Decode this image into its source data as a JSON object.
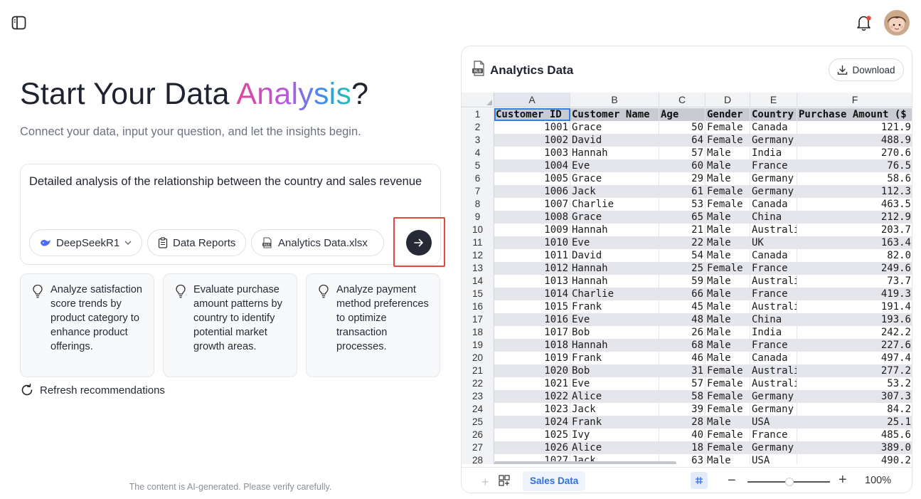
{
  "hero": {
    "title_prefix": "Start Your Data ",
    "title_highlight": "Analysis",
    "title_suffix": "?",
    "subtitle": "Connect your data, input your question, and let the insights begin."
  },
  "prompt": {
    "text": "Detailed analysis of the relationship between the country and sales revenue",
    "chips": [
      {
        "label": "DeepSeekR1",
        "icon": "deepseek-whale-icon"
      },
      {
        "label": "Data Reports",
        "icon": "clipboard-icon"
      },
      {
        "label": "Analytics Data.xlsx",
        "icon": "xls-file-icon"
      }
    ]
  },
  "suggestions": [
    "Analyze satisfaction score trends by product category to enhance product offerings.",
    "Evaluate purchase amount patterns by country to identify potential market growth areas.",
    "Analyze payment method preferences to optimize transaction processes."
  ],
  "refresh_label": "Refresh recommendations",
  "disclaimer": "The content is AI-generated. Please verify carefully.",
  "panel": {
    "title": "Analytics Data",
    "download_label": "Download",
    "sheet_tab": "Sales Data",
    "zoom": "100%"
  },
  "sheet": {
    "columns": [
      "A",
      "B",
      "C",
      "D",
      "E",
      "F"
    ],
    "row_numbers": [
      "1",
      "2",
      "3",
      "4",
      "5",
      "6",
      "7",
      "8",
      "9",
      "10",
      "11",
      "12",
      "13",
      "14",
      "15",
      "16",
      "17",
      "18",
      "19",
      "20",
      "21",
      "22",
      "23",
      "24",
      "25",
      "26",
      "27",
      "28"
    ],
    "header": [
      "Customer ID",
      "Customer Name",
      "Age",
      "Gender",
      "Country",
      "Purchase Amount ($"
    ],
    "rows": [
      [
        "1001",
        "Grace",
        "50",
        "Female",
        "Canada",
        "121.9"
      ],
      [
        "1002",
        "David",
        "64",
        "Female",
        "Germany",
        "488.9"
      ],
      [
        "1003",
        "Hannah",
        "57",
        "Male",
        "India",
        "270.6"
      ],
      [
        "1004",
        "Eve",
        "60",
        "Male",
        "France",
        "76.5"
      ],
      [
        "1005",
        "Grace",
        "29",
        "Male",
        "Germany",
        "58.6"
      ],
      [
        "1006",
        "Jack",
        "61",
        "Female",
        "Germany",
        "112.3"
      ],
      [
        "1007",
        "Charlie",
        "53",
        "Female",
        "Canada",
        "463.5"
      ],
      [
        "1008",
        "Grace",
        "65",
        "Male",
        "China",
        "212.9"
      ],
      [
        "1009",
        "Hannah",
        "21",
        "Male",
        "Australi",
        "203.7"
      ],
      [
        "1010",
        "Eve",
        "22",
        "Male",
        "UK",
        "163.4"
      ],
      [
        "1011",
        "David",
        "54",
        "Male",
        "Canada",
        "82.0"
      ],
      [
        "1012",
        "Hannah",
        "25",
        "Female",
        "France",
        "249.6"
      ],
      [
        "1013",
        "Hannah",
        "59",
        "Male",
        "Australi",
        "73.7"
      ],
      [
        "1014",
        "Charlie",
        "66",
        "Male",
        "France",
        "419.3"
      ],
      [
        "1015",
        "Frank",
        "45",
        "Male",
        "Australi",
        "191.4"
      ],
      [
        "1016",
        "Eve",
        "48",
        "Male",
        "China",
        "193.6"
      ],
      [
        "1017",
        "Bob",
        "26",
        "Male",
        "India",
        "242.2"
      ],
      [
        "1018",
        "Hannah",
        "68",
        "Male",
        "France",
        "227.6"
      ],
      [
        "1019",
        "Frank",
        "46",
        "Male",
        "Canada",
        "497.4"
      ],
      [
        "1020",
        "Bob",
        "31",
        "Female",
        "Australi",
        "277.2"
      ],
      [
        "1021",
        "Eve",
        "57",
        "Female",
        "Australi",
        "53.2"
      ],
      [
        "1022",
        "Alice",
        "58",
        "Female",
        "Germany",
        "307.3"
      ],
      [
        "1023",
        "Jack",
        "39",
        "Female",
        "Germany",
        "84.2"
      ],
      [
        "1024",
        "Frank",
        "28",
        "Male",
        "USA",
        "25.1"
      ],
      [
        "1025",
        "Ivy",
        "40",
        "Female",
        "France",
        "485.6"
      ],
      [
        "1026",
        "Alice",
        "18",
        "Female",
        "Germany",
        "389.0"
      ],
      [
        "1027",
        "Jack",
        "63",
        "Male",
        "USA",
        "490.2"
      ]
    ]
  },
  "colors": {
    "accent_gradient": [
      "#e0459a",
      "#b35be0",
      "#3f8cf0",
      "#23c3b5"
    ],
    "send_button": "#262a36",
    "highlight_outline": "#e2483b",
    "sheet_tab_text": "#2f6fde",
    "notification_dot": "#e8453c"
  }
}
